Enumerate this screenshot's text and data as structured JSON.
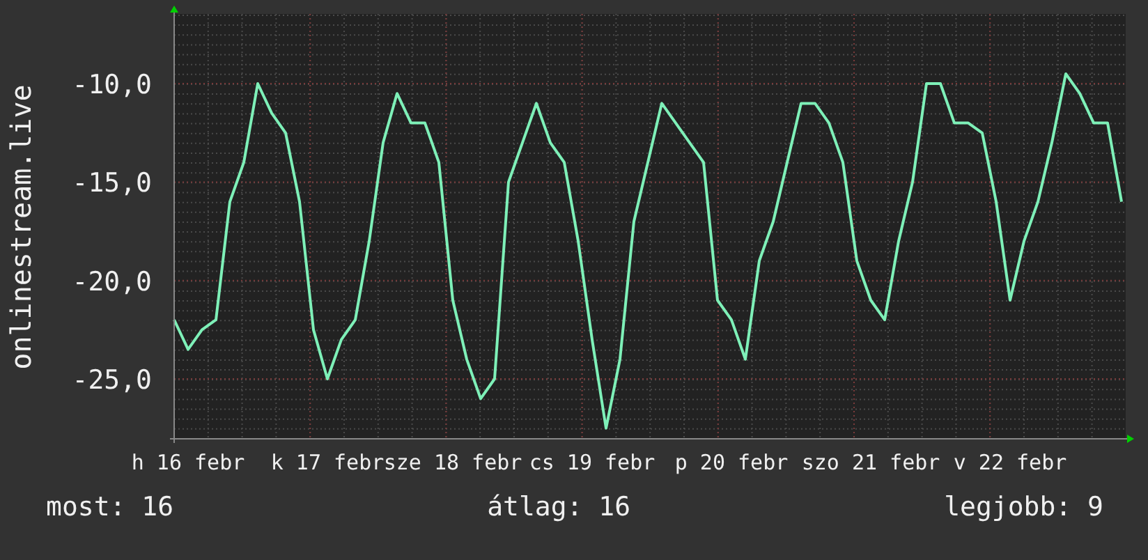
{
  "chart_data": {
    "type": "line",
    "ylabel": "onlinestream.live",
    "grid": true,
    "categories": [
      null,
      "h 16 febr",
      null,
      null,
      null,
      null,
      null,
      null,
      null,
      null,
      null,
      "k 17 febr",
      null,
      null,
      null,
      null,
      null,
      null,
      null,
      null,
      "sze 18 febr",
      null,
      null,
      null,
      null,
      null,
      null,
      null,
      null,
      null,
      "cs 19 febr",
      null,
      null,
      null,
      null,
      null,
      null,
      null,
      null,
      null,
      "p 20 febr",
      null,
      null,
      null,
      null,
      null,
      null,
      null,
      null,
      null,
      "szo 21 febr",
      null,
      null,
      null,
      null,
      null,
      null,
      null,
      null,
      null,
      "v 22 febr",
      null,
      null,
      null,
      null,
      null,
      null,
      null,
      null
    ],
    "ylim": [
      -28.04,
      -6.46
    ],
    "yticks": [
      {
        "value": -10,
        "label": "-10,0"
      },
      {
        "value": -15,
        "label": "-15,0"
      },
      {
        "value": -20,
        "label": "-20,0"
      },
      {
        "value": -25,
        "label": "-25,0"
      }
    ],
    "series": [
      {
        "color": "#7ef0b8",
        "values": [
          -22,
          -23.5,
          -22.5,
          -22,
          -16,
          -14,
          -10,
          -11.5,
          -12.5,
          -16,
          -22.5,
          -25,
          -23,
          -22,
          -18,
          -13,
          -10.5,
          -12,
          -12,
          -14,
          -21,
          -24,
          -26,
          -25,
          -15,
          -13,
          -11,
          -13,
          -14,
          -18,
          -23,
          -27.5,
          -24,
          -17,
          -14,
          -11,
          -12,
          -13,
          -14,
          -21,
          -22,
          -24,
          -19,
          -17,
          -14,
          -11,
          -11,
          -12,
          -14,
          -19,
          -21,
          -22,
          -18,
          -15,
          -10,
          -10,
          -12,
          -12,
          -12.5,
          -16,
          -21,
          -18,
          -16,
          -13,
          -9.5,
          -10.5,
          -12,
          -12,
          -16
        ]
      }
    ]
  },
  "legend": [
    "most: 16",
    "átlag: 16",
    "legjobb: 9"
  ]
}
